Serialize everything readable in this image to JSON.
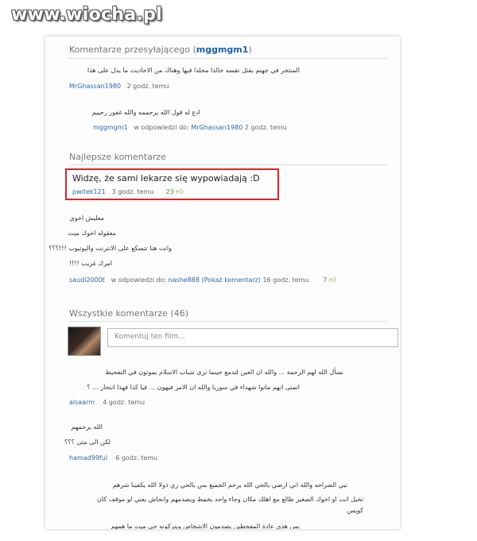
{
  "watermark": "www.wiocha.pl",
  "uploader": {
    "heading": "Komentarze przesyłającego (",
    "user": "mggmgm1",
    "heading_end": ")",
    "comment1": {
      "text": "المنتحر في جهنم بقتل نفسه خالدا مخلدا فيها وهناك من الاحاديث ما يدل على هذا",
      "author": "MrGhassan1980",
      "time": "2 godz. temu"
    },
    "reply1": {
      "text": "ادع له قول الله يرحممه والله غفور رحييم",
      "author": "mggmgm1",
      "reply_to_label": "w odpowiedzi do:",
      "reply_to": "MrGhassan1980",
      "time": "2 godz. temu"
    }
  },
  "best": {
    "heading": "Najlepsze komentarze",
    "comment": {
      "text": "Widzę, że sami lekarze się wypowiadają :D",
      "author": "pwitek121",
      "time": "3 godz. temu",
      "likes": "23"
    },
    "reply": {
      "lines": [
        "معليش اخوي",
        "معقوله اخوك ميت",
        "وانت هنا تتسكع على الانترنت واليوتيوب !!!؟؟؟",
        "امرك غريب !!!!"
      ],
      "author": "saudi2000t",
      "reply_to_label": "w odpowiedzi do:",
      "reply_to": "nashe888",
      "show_comment": "(Pokaż komentarz)",
      "time": "16 godz. temu",
      "likes": "7"
    }
  },
  "all": {
    "heading": "Wszystkie komentarze (46)",
    "input_placeholder": "Komentuj ten film...",
    "comments": [
      {
        "lines": [
          "نسأل الله لهم الرحمة ... والله ان العين لتدمع حينما نرى شباب الاسلام يموتون في التفحيط",
          "اتمنى انهم ماتوا شهداء في سوريا والله ان الامر فيهون ... فيا كذا فهذا انتحار ... ؟"
        ],
        "author": "alsaarm",
        "time": "4 godz. temu"
      },
      {
        "lines": [
          "الله يرحمهم",
          "لكن الى متى ؟؟؟"
        ],
        "author": "hamad99ful",
        "time": "6 godz. temu"
      },
      {
        "lines": [
          "نبي الصراحه والله اني ارضي بالحي الله يرحم الجميع بس بالحي زي ذولا الله يكفينا شرهم",
          "تخيل انت او اخوك الصغير طالع مع اهلك مكان وجاء واحد يخمط ويصدمهم وانحاش يعني لو موقف كان",
          "كويس",
          "بس هذي عادة المفحطين يصدمون الاشخاص ويتركونه حي ميت ما همهم"
        ]
      }
    ]
  },
  "colors": {
    "link": "#1c5fa8",
    "highlight_border": "#d9252b",
    "likes": "#3c9a35"
  }
}
